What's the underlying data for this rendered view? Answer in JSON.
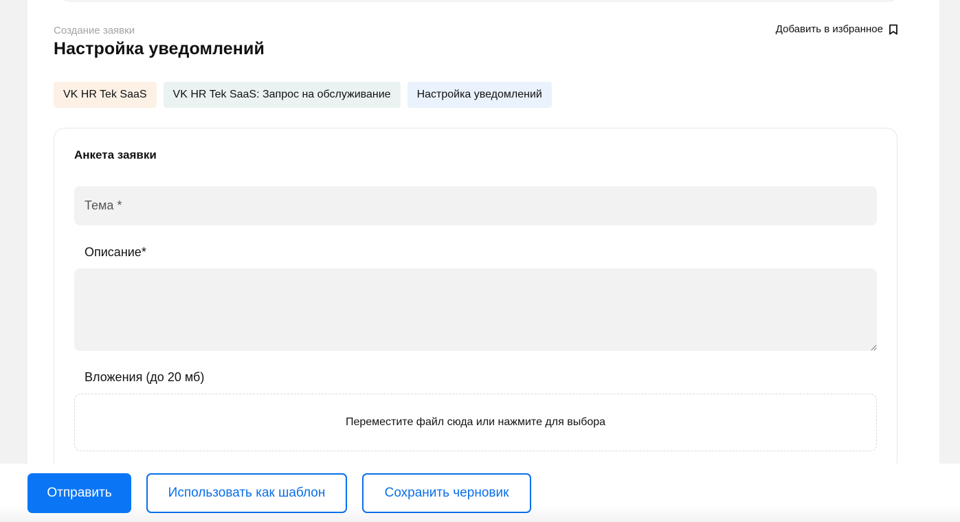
{
  "header": {
    "breadcrumb": "Создание заявки",
    "title": "Настройка уведомлений",
    "favorite_label": "Добавить в избранное",
    "favorite_icon": "bookmark-icon"
  },
  "tags": [
    {
      "label": "VK HR Tek SaaS",
      "color": "#fdf1e6"
    },
    {
      "label": "VK HR Tek SaaS: Запрос на обслуживание",
      "color": "#ebf3f2"
    },
    {
      "label": "Настройка уведомлений",
      "color": "#eaf2fd"
    }
  ],
  "form": {
    "title": "Анкета заявки",
    "subject": {
      "value": "",
      "placeholder": "Тема *"
    },
    "description": {
      "label": "Описание*",
      "value": ""
    },
    "attachments": {
      "label": "Вложения (до 20 мб)",
      "dropzone_text": "Переместите файл сюда или нажмите для выбора"
    }
  },
  "actions": {
    "submit_label": "Отправить",
    "template_label": "Использовать как шаблон",
    "draft_label": "Сохранить черновик",
    "primary_color": "#0a76f6"
  }
}
